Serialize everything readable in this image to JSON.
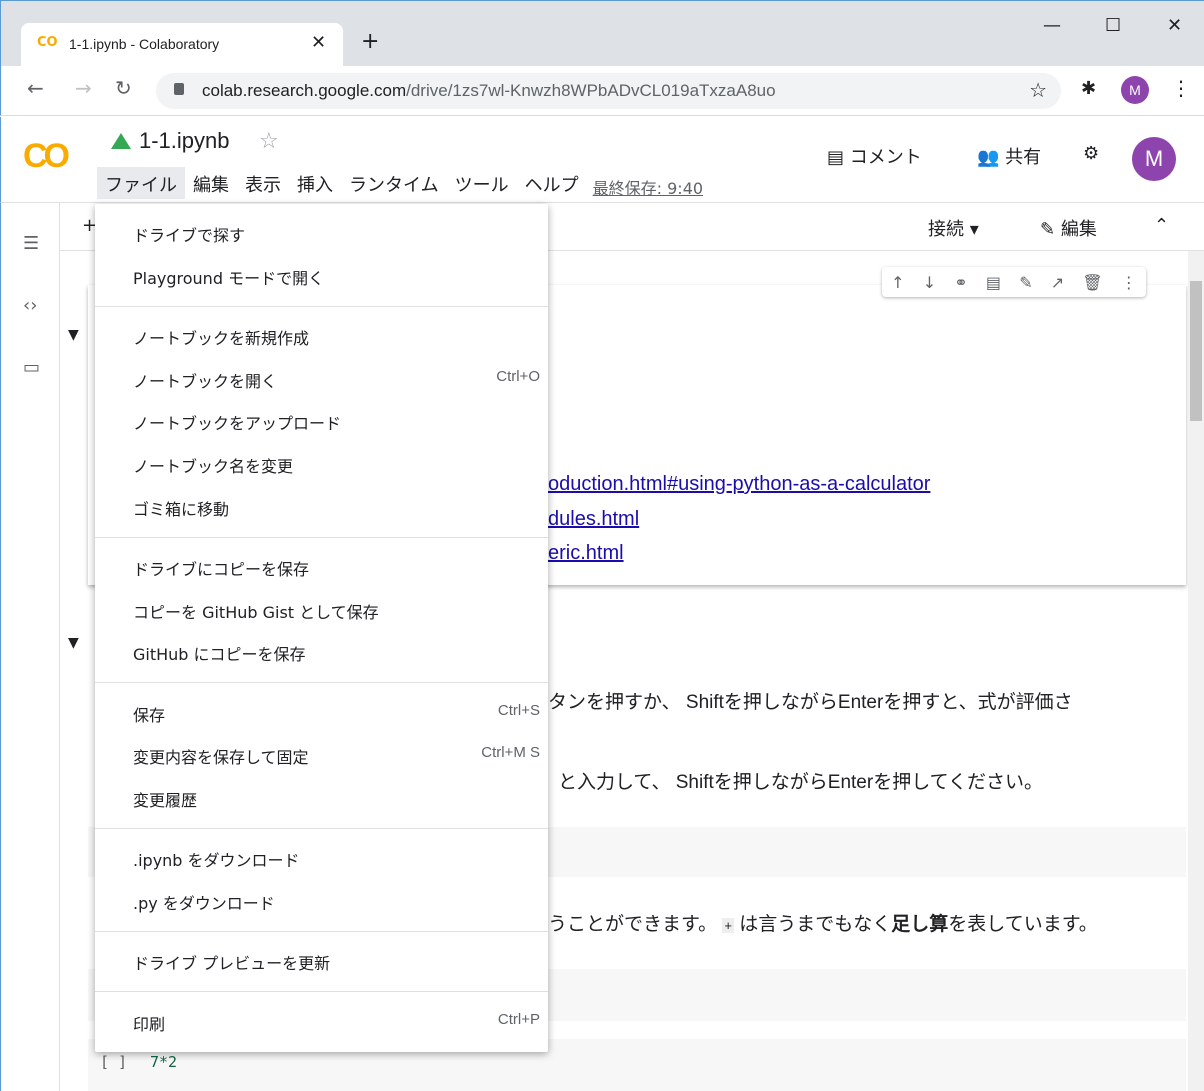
{
  "browser": {
    "tab_title": "1-1.ipynb - Colaboratory",
    "tab_favicon": "CO",
    "url_host": "colab.research.google.com",
    "url_path": "/drive/1zs7wl-Knwzh8WPbADvCL019aTxzaA8uo",
    "profile_initial": "M"
  },
  "colab": {
    "notebook_title": "1-1.ipynb",
    "logo": "CO",
    "menus": [
      "ファイル",
      "編集",
      "表示",
      "挿入",
      "ランタイム",
      "ツール",
      "ヘルプ"
    ],
    "last_saved": "最終保存: 9:40",
    "comment_label": "コメント",
    "share_label": "共有",
    "avatar_initial": "M",
    "connect_label": "接続",
    "edit_label": "編集"
  },
  "notebook": {
    "links": [
      "oduction.html#using-python-as-a-calculator",
      "dules.html",
      "eric.html"
    ],
    "para1": "タンを押すか、 Shiftを押しながらEnterを押すと、式が評価さ",
    "para2": "と入力して、 Shiftを押しながらEnterを押してください。",
    "para3_a": "うことができます。",
    "para3_plus": "+",
    "para3_b": " は言うまでもなく",
    "para3_bold": "足し算",
    "para3_c": "を表しています。",
    "code_prompt": "[ ]",
    "code_text": "7*2"
  },
  "file_menu": {
    "items": [
      {
        "label": "ドライブで探す",
        "shortcut": ""
      },
      {
        "label": "Playground モードで開く",
        "shortcut": ""
      },
      {
        "label": "ノートブックを新規作成",
        "shortcut": ""
      },
      {
        "label": "ノートブックを開く",
        "shortcut": "Ctrl+O"
      },
      {
        "label": "ノートブックをアップロード",
        "shortcut": ""
      },
      {
        "label": "ノートブック名を変更",
        "shortcut": ""
      },
      {
        "label": "ゴミ箱に移動",
        "shortcut": ""
      },
      {
        "label": "ドライブにコピーを保存",
        "shortcut": ""
      },
      {
        "label": "コピーを GitHub Gist として保存",
        "shortcut": ""
      },
      {
        "label": "GitHub にコピーを保存",
        "shortcut": ""
      },
      {
        "label": "保存",
        "shortcut": "Ctrl+S"
      },
      {
        "label": "変更内容を保存して固定",
        "shortcut": "Ctrl+M S"
      },
      {
        "label": "変更履歴",
        "shortcut": ""
      },
      {
        "label": ".ipynb をダウンロード",
        "shortcut": ""
      },
      {
        "label": ".py をダウンロード",
        "shortcut": ""
      },
      {
        "label": "ドライブ プレビューを更新",
        "shortcut": ""
      },
      {
        "label": "印刷",
        "shortcut": "Ctrl+P"
      }
    ]
  },
  "colors": {
    "accent": "#f9ab00",
    "avatar": "#8e44ad",
    "link": "#1a0dab"
  }
}
